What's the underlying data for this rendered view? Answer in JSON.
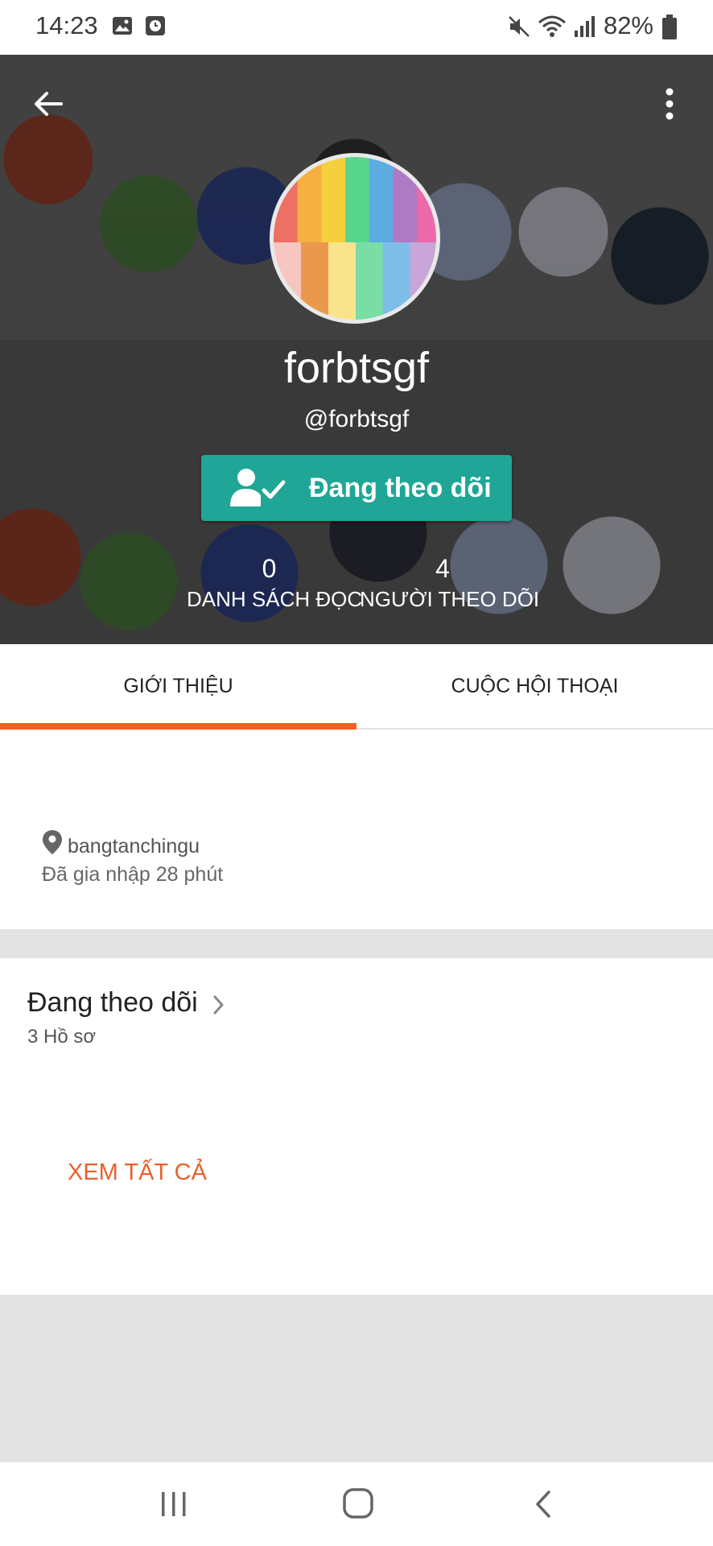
{
  "status_bar": {
    "time": "14:23",
    "battery": "82%",
    "icons": [
      "image-icon",
      "clock-icon",
      "mute-icon",
      "wifi-icon",
      "signal-icon",
      "battery-icon"
    ]
  },
  "profile": {
    "name": "forbtsgf",
    "handle": "@forbtsgf",
    "follow_button_label": "Đang theo dõi",
    "stats": [
      {
        "value": "0",
        "label": "DANH SÁCH ĐỌC"
      },
      {
        "value": "4",
        "label": "NGƯỜI THEO DÕI"
      }
    ]
  },
  "tabs": [
    {
      "label": "GIỚI THIỆU",
      "active": true
    },
    {
      "label": "CUỘC HỘI THOẠI",
      "active": false
    }
  ],
  "about": {
    "location": "bangtanchingu",
    "joined": "Đã gia nhập 28 phút"
  },
  "following": {
    "title": "Đang theo dõi",
    "count": "3 Hồ sơ",
    "see_all": "XEM TẤT CẢ"
  },
  "colors": {
    "accent": "#ff5a1f",
    "follow_button": "#1fa696",
    "see_all": "#e8612c"
  }
}
